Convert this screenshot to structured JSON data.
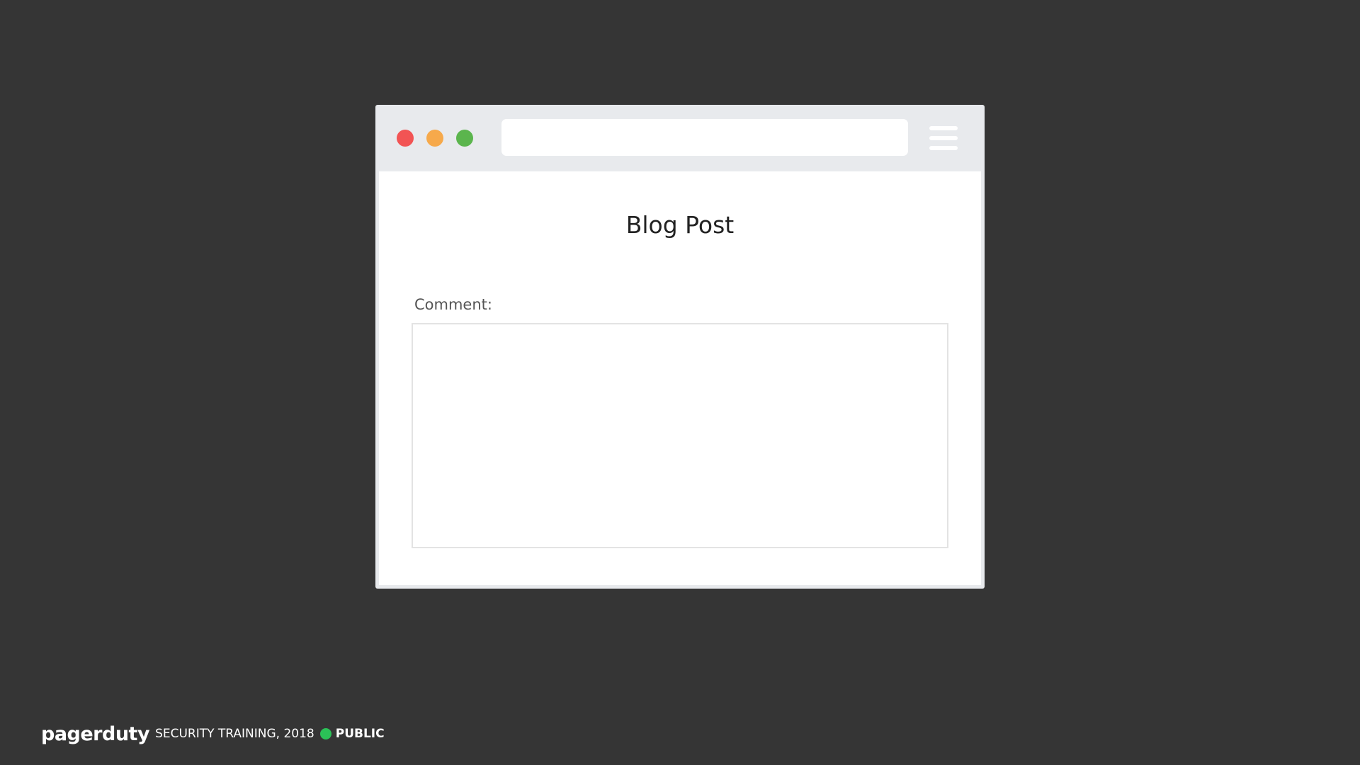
{
  "browser": {
    "address_value": "",
    "window_controls": {
      "close_color": "#f25454",
      "minimize_color": "#f6a94b",
      "maximize_color": "#5bb54d"
    },
    "menu_icon": "hamburger-menu-icon"
  },
  "page": {
    "title": "Blog Post",
    "comment_label": "Comment:",
    "comment_value": ""
  },
  "footer": {
    "logo": "pagerduty",
    "text": "SECURITY TRAINING, 2018",
    "status": "PUBLIC",
    "status_color": "#2bc257"
  }
}
